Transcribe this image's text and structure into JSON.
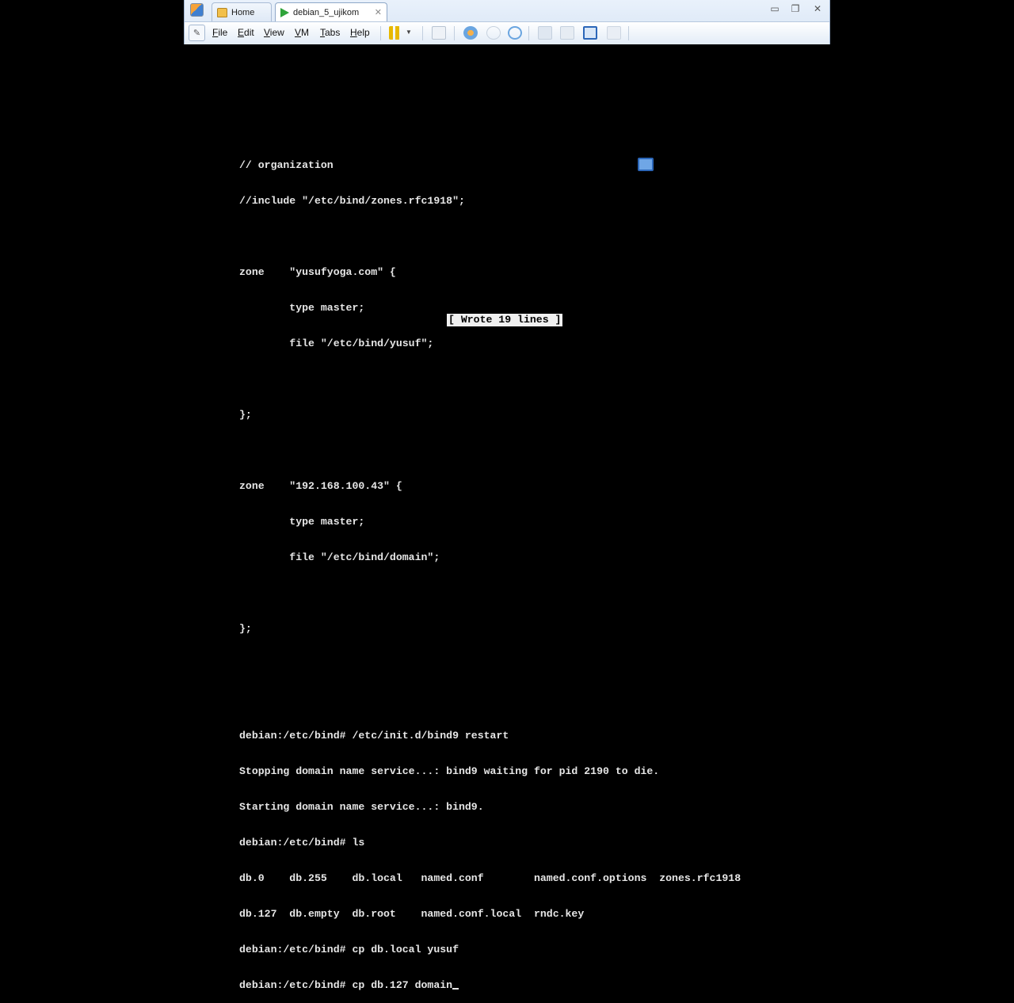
{
  "tabs": [
    {
      "label": "Home",
      "active": false,
      "closable": false
    },
    {
      "label": "debian_5_ujikom",
      "active": true,
      "closable": true
    }
  ],
  "window_controls": {
    "minimize": "▭",
    "restore": "❐",
    "close": "✕"
  },
  "menu": [
    "File",
    "Edit",
    "View",
    "VM",
    "Tabs",
    "Help"
  ],
  "icons": {
    "grip": "pin-icon",
    "pause": "pause-icon",
    "pause_dropdown": "chevron-down-icon",
    "tab_close": "✕"
  },
  "terminal": {
    "lines": [
      "// organization",
      "//include \"/etc/bind/zones.rfc1918\";",
      "",
      "zone    \"yusufyoga.com\" {",
      "        type master;",
      "        file \"/etc/bind/yusuf\";",
      "",
      "};",
      "",
      "zone    \"192.168.100.43\" {",
      "        type master;",
      "        file \"/etc/bind/domain\";",
      "",
      "};",
      "",
      "",
      "debian:/etc/bind# /etc/init.d/bind9 restart",
      "Stopping domain name service...: bind9 waiting for pid 2190 to die.",
      "Starting domain name service...: bind9.",
      "debian:/etc/bind# ls",
      "db.0    db.255    db.local   named.conf        named.conf.options  zones.rfc1918",
      "db.127  db.empty  db.root    named.conf.local  rndc.key",
      "debian:/etc/bind# cp db.local yusuf",
      "debian:/etc/bind# cp db.127 domain"
    ],
    "status_message": "[ Wrote 19 lines ]"
  },
  "colors": {
    "terminal_bg": "#000000",
    "terminal_fg": "#e6e6e6",
    "status_bg": "#f0f0f0",
    "chrome": "#d7e4f4"
  }
}
